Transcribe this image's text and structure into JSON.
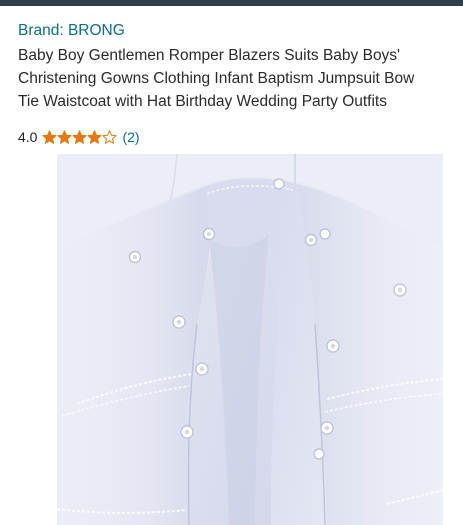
{
  "brand": {
    "label": "Brand: BRONG"
  },
  "product": {
    "title_lines": [
      "Baby Boy Gentlemen Romper Blazers Suits Baby Boys'",
      "Christening Gowns Clothing Infant Baptism Jumpsuit Bow",
      "Tie Waistcoat with Hat Birthday Wedding Party Outfits"
    ]
  },
  "rating": {
    "score": "4.0",
    "stars_value": 4.0,
    "stars_max": 5,
    "count": "(2)",
    "star_color": "#e47911"
  },
  "image": {
    "name": "product-photo-romper-crotch-snaps"
  },
  "colors": {
    "brand_link": "#0a6f8e",
    "top_bar": "#2f3e4c"
  }
}
